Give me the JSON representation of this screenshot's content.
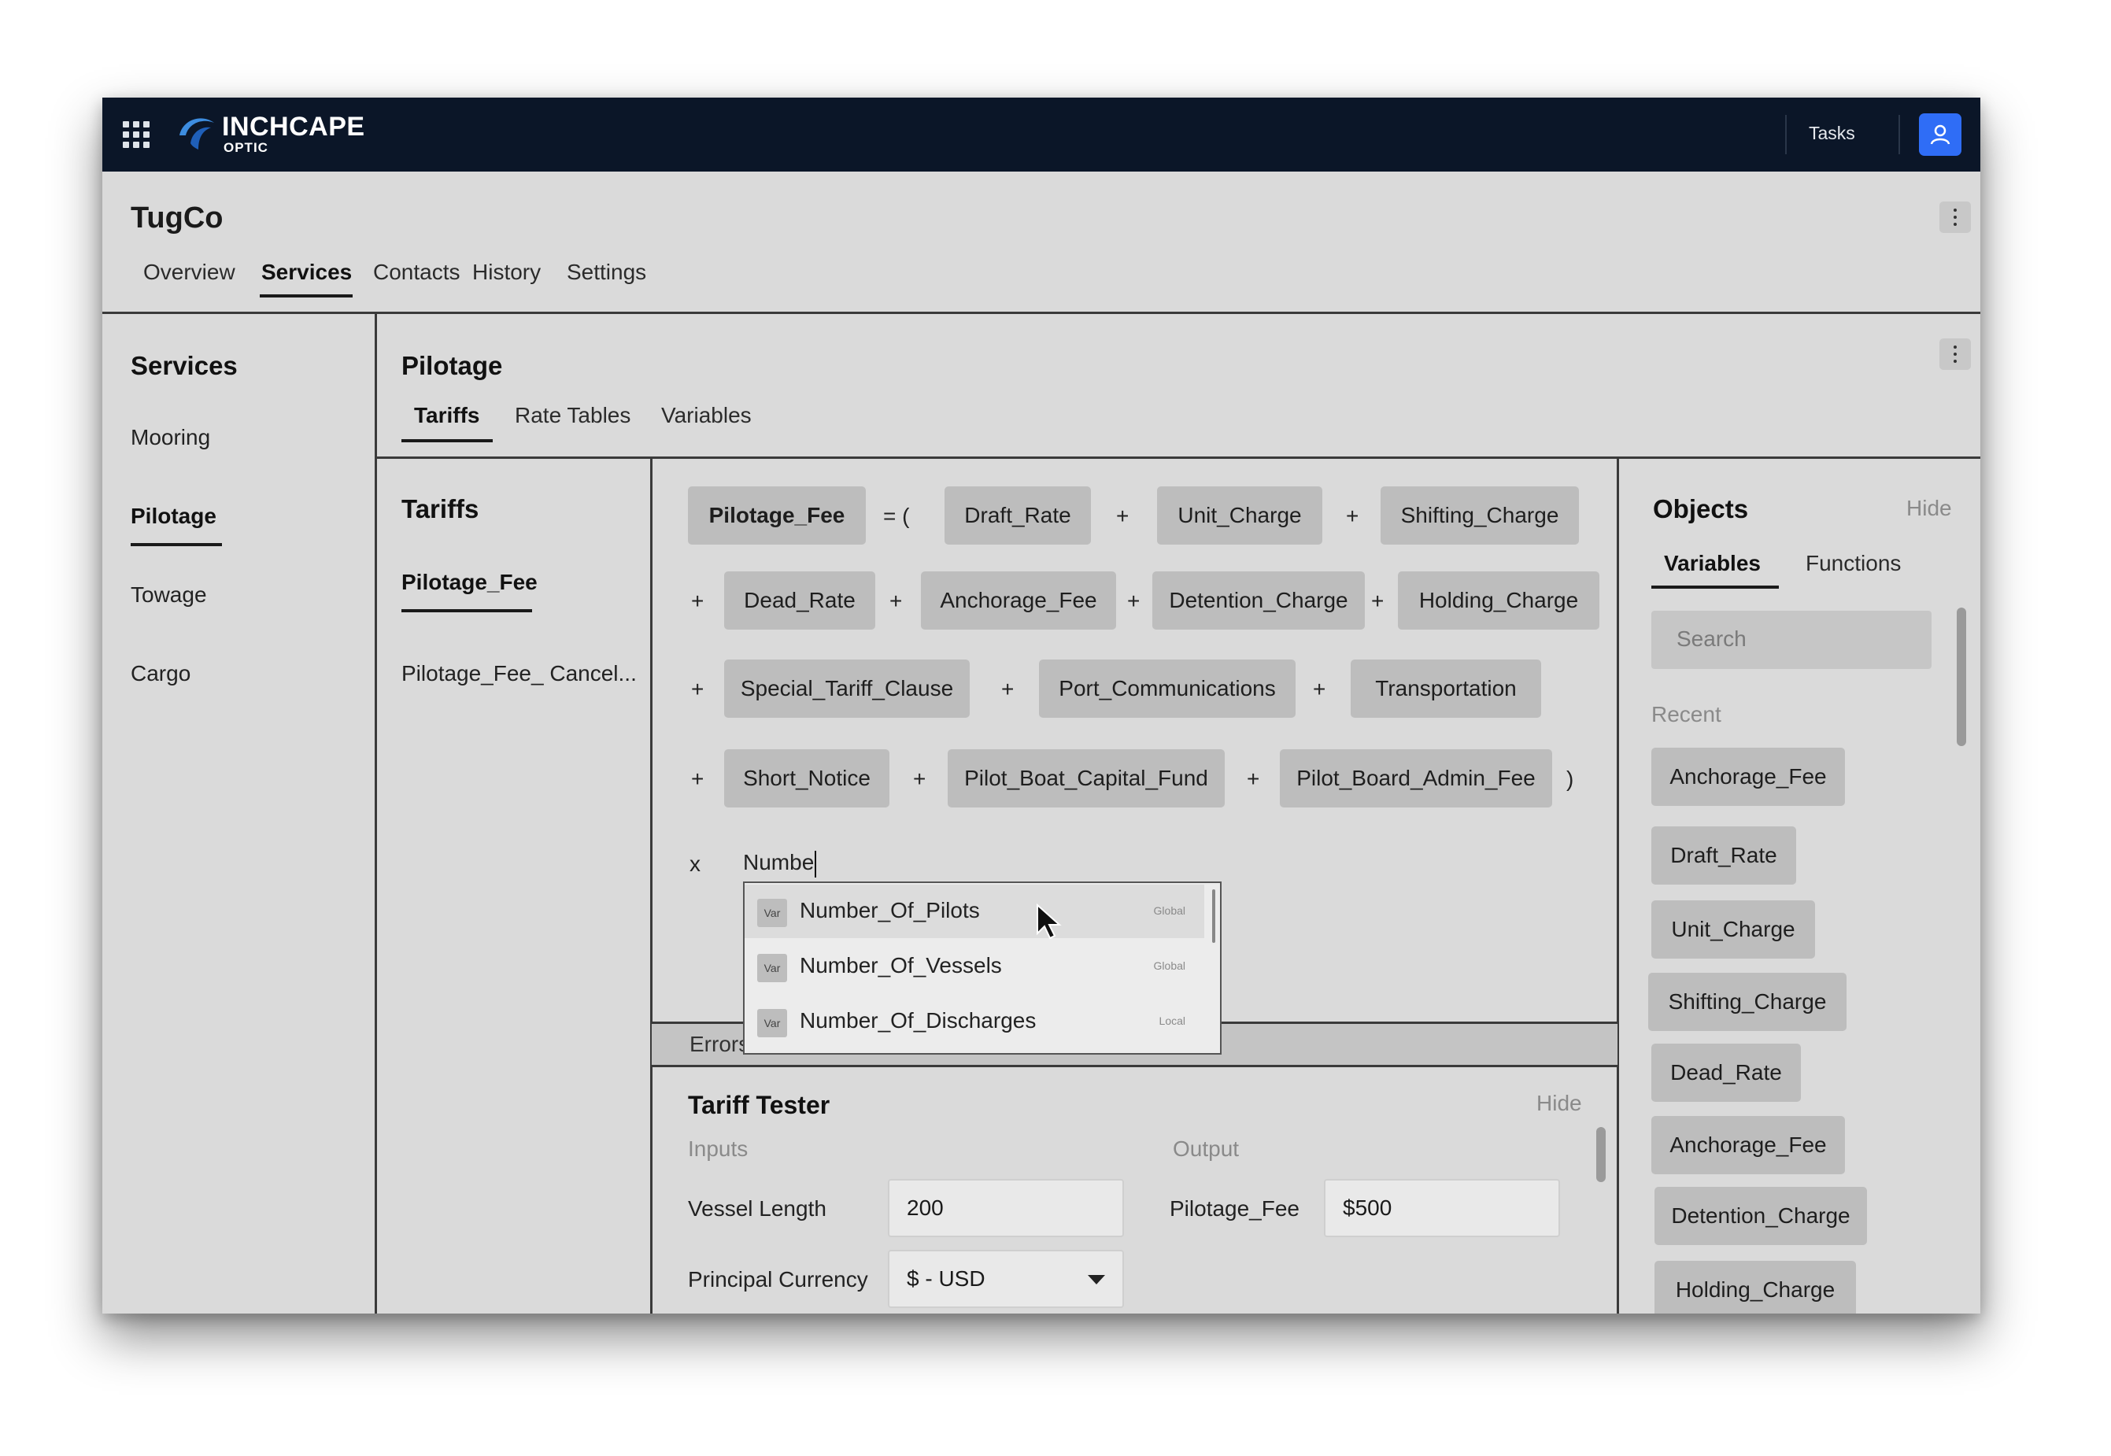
{
  "topbar": {
    "brand": "INCHCAPE",
    "brand_sub": "OPTIC",
    "tasks_label": "Tasks"
  },
  "header": {
    "company": "TugCo",
    "tabs": [
      "Overview",
      "Services",
      "Contacts",
      "History",
      "Settings"
    ],
    "active_tab": "Services"
  },
  "services_sidebar": {
    "title": "Services",
    "items": [
      "Mooring",
      "Pilotage",
      "Towage",
      "Cargo"
    ],
    "active": "Pilotage"
  },
  "service": {
    "title": "Pilotage",
    "tabs": [
      "Tariffs",
      "Rate Tables",
      "Variables"
    ],
    "active_tab": "Tariffs"
  },
  "tariffs_list": {
    "title": "Tariffs",
    "items": [
      "Pilotage_Fee",
      "Pilotage_Fee_ Cancel..."
    ],
    "active": "Pilotage_Fee"
  },
  "formula": {
    "lhs": "Pilotage_Fee",
    "equals": "= (",
    "plus": "+",
    "close_paren": ")",
    "times": "x",
    "terms": [
      "Draft_Rate",
      "Unit_Charge",
      "Shifting_Charge",
      "Dead_Rate",
      "Anchorage_Fee",
      "Detention_Charge",
      "Holding_Charge",
      "Special_Tariff_Clause",
      "Port_Communications",
      "Transportation",
      "Short_Notice",
      "Pilot_Boat_Capital_Fund",
      "Pilot_Board_Admin_Fee"
    ],
    "typed_text": "Numbe"
  },
  "autocomplete": {
    "items": [
      {
        "badge": "Var",
        "label": "Number_Of_Pilots",
        "scope": "Global"
      },
      {
        "badge": "Var",
        "label": "Number_Of_Vessels",
        "scope": "Global"
      },
      {
        "badge": "Var",
        "label": "Number_Of_Discharges",
        "scope": "Local"
      }
    ]
  },
  "errors": {
    "label": "Errors"
  },
  "tester": {
    "title": "Tariff Tester",
    "hide_label": "Hide",
    "inputs_label": "Inputs",
    "output_label": "Output",
    "vessel_length_label": "Vessel Length",
    "vessel_length_value": "200",
    "currency_label": "Principal Currency",
    "currency_value": "$ - USD",
    "output_name": "Pilotage_Fee",
    "output_value": "$500"
  },
  "objects": {
    "title": "Objects",
    "hide_label": "Hide",
    "tabs": [
      "Variables",
      "Functions"
    ],
    "active_tab": "Variables",
    "search_placeholder": "Search",
    "recent_label": "Recent",
    "recent": [
      "Anchorage_Fee",
      "Draft_Rate",
      "Unit_Charge",
      "Shifting_Charge",
      "Dead_Rate",
      "Anchorage_Fee",
      "Detention_Charge",
      "Holding_Charge"
    ]
  },
  "colors": {
    "topbar": "#0b1628",
    "accent_blue": "#2f6df6",
    "panel_bg": "#dadada",
    "chip_bg": "#bdbdbd"
  },
  "icons": [
    "apps-grid-icon",
    "inchcape-logo-icon",
    "user-icon",
    "kebab-menu-icon",
    "chevron-down-icon",
    "mouse-pointer-icon"
  ]
}
